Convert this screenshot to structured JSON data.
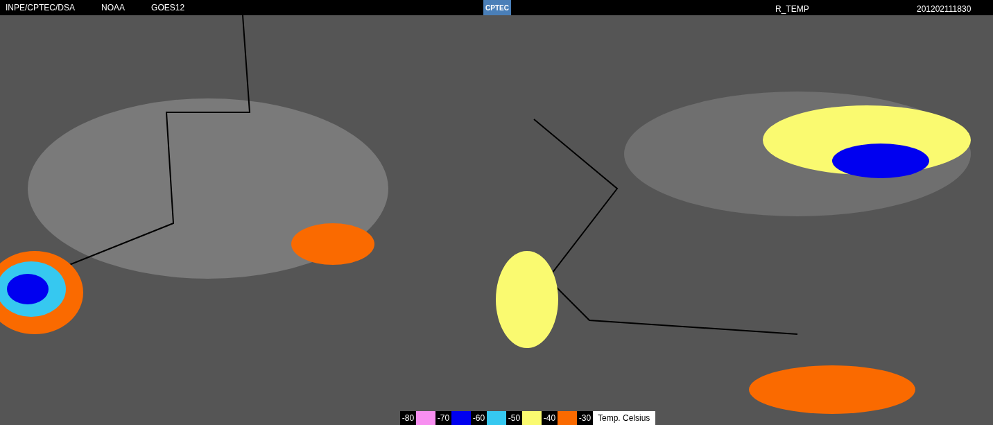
{
  "header": {
    "left": [
      "INPE/CPTEC/DSA",
      "NOAA",
      "GOES12"
    ],
    "logo": "CPTEC",
    "product": "R_TEMP",
    "timestamp": "201202111830"
  },
  "legend": {
    "items": [
      {
        "label": "-80",
        "color": "#f78ff0"
      },
      {
        "label": "-70",
        "color": "#0000f0"
      },
      {
        "label": "-60",
        "color": "#36c8f0"
      },
      {
        "label": "-50",
        "color": "#fafa70"
      },
      {
        "label": "-40",
        "color": "#fa6a00"
      },
      {
        "label": "-30"
      }
    ],
    "title": "Temp. Celsius"
  }
}
